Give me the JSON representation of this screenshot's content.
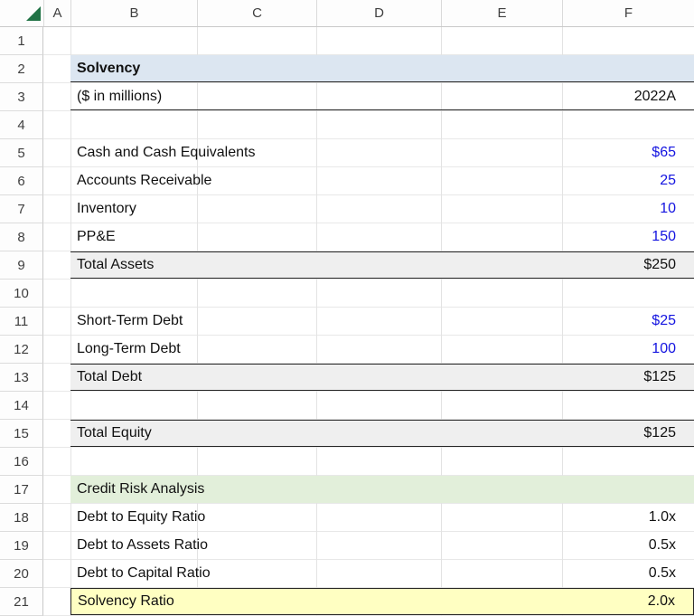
{
  "columns": [
    "A",
    "B",
    "C",
    "D",
    "E",
    "F"
  ],
  "colors": {
    "title_fill": "#DCE6F1",
    "total_fill": "#EFEFEF",
    "green_fill": "#E2EFDA",
    "highlight_fill": "#FFFFC2",
    "input_blue": "#1414E0",
    "select_all_green": "#217346"
  },
  "rows": [
    {
      "n": 1,
      "type": "blank"
    },
    {
      "n": 2,
      "type": "title",
      "label": "Solvency"
    },
    {
      "n": 3,
      "type": "subhead",
      "label": "($ in millions)",
      "value": "2022A"
    },
    {
      "n": 4,
      "type": "blank"
    },
    {
      "n": 5,
      "type": "item",
      "label": "Cash and Cash Equivalents",
      "value": "$65",
      "value_color": "blue"
    },
    {
      "n": 6,
      "type": "item",
      "label": "Accounts Receivable",
      "value": "25",
      "value_color": "blue"
    },
    {
      "n": 7,
      "type": "item",
      "label": "Inventory",
      "value": "10",
      "value_color": "blue"
    },
    {
      "n": 8,
      "type": "item",
      "label": "PP&E",
      "value": "150",
      "value_color": "blue"
    },
    {
      "n": 9,
      "type": "total",
      "label": "Total Assets",
      "value": "$250"
    },
    {
      "n": 10,
      "type": "blank"
    },
    {
      "n": 11,
      "type": "item",
      "label": "Short-Term Debt",
      "value": "$25",
      "value_color": "blue"
    },
    {
      "n": 12,
      "type": "item",
      "label": "Long-Term Debt",
      "value": "100",
      "value_color": "blue"
    },
    {
      "n": 13,
      "type": "total",
      "label": "Total Debt",
      "value": "$125"
    },
    {
      "n": 14,
      "type": "blank"
    },
    {
      "n": 15,
      "type": "total",
      "label": "Total Equity",
      "value": "$125"
    },
    {
      "n": 16,
      "type": "blank"
    },
    {
      "n": 17,
      "type": "green",
      "label": "Credit Risk Analysis"
    },
    {
      "n": 18,
      "type": "item",
      "label": "Debt to Equity Ratio",
      "value": "1.0x"
    },
    {
      "n": 19,
      "type": "item",
      "label": "Debt to Assets Ratio",
      "value": "0.5x"
    },
    {
      "n": 20,
      "type": "item",
      "label": "Debt to Capital Ratio",
      "value": "0.5x"
    },
    {
      "n": 21,
      "type": "highlight",
      "label": "Solvency Ratio",
      "value": "2.0x"
    }
  ]
}
